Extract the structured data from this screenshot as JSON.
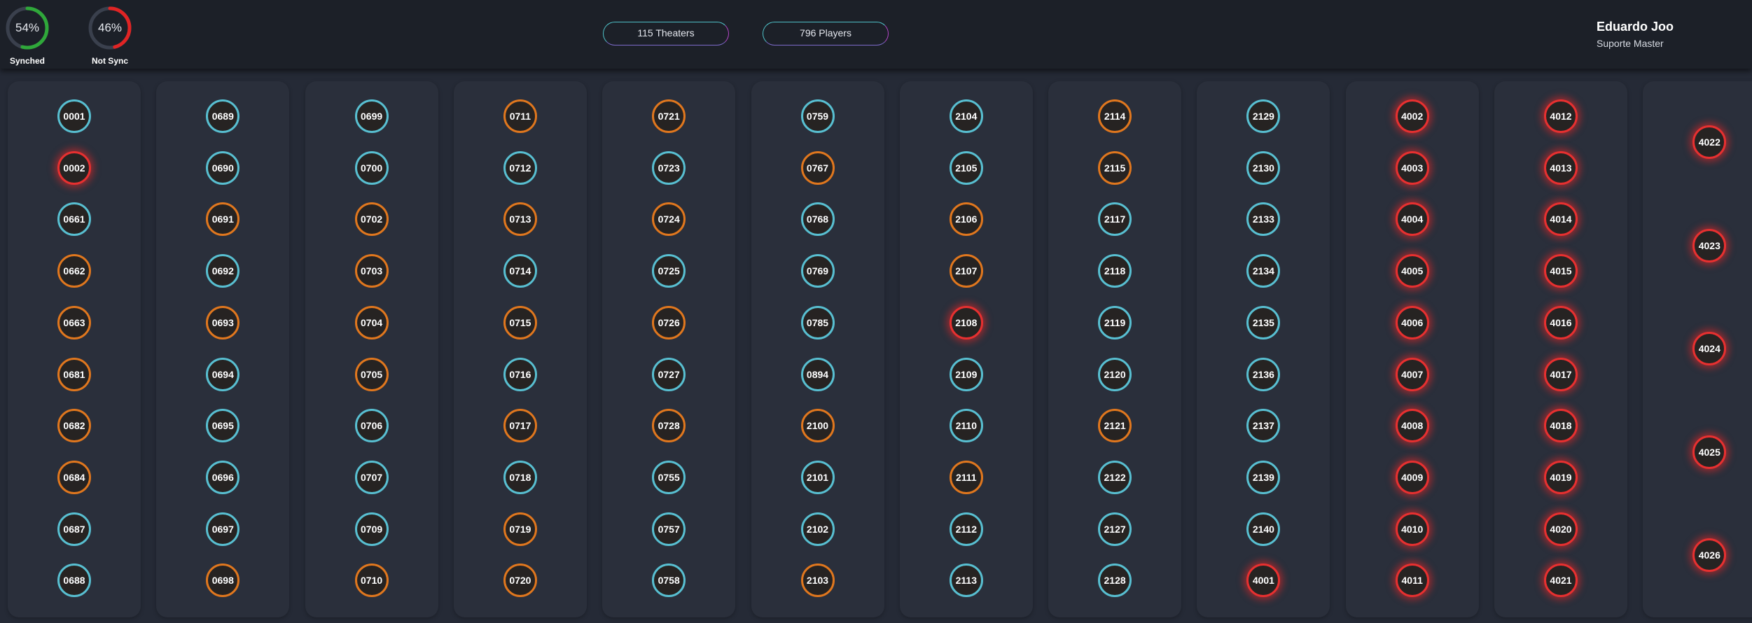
{
  "header": {
    "gauges": [
      {
        "value_text": "54%",
        "label": "Synched",
        "fraction": 0.54,
        "color": "#2fa83a"
      },
      {
        "value_text": "46%",
        "label": "Not Sync",
        "fraction": 0.46,
        "color": "#e02424"
      }
    ],
    "theaters_label": "115 Theaters",
    "players_label": "796 Players",
    "user": {
      "name": "Eduardo Joo",
      "role": "Suporte Master"
    }
  },
  "colors": {
    "ok": "#58bfd1",
    "warn": "#e0771e",
    "err": "#e73030"
  },
  "columns": [
    [
      [
        "0001",
        "ok"
      ],
      [
        "0002",
        "err"
      ],
      [
        "0661",
        "ok"
      ],
      [
        "0662",
        "warn"
      ],
      [
        "0663",
        "warn"
      ],
      [
        "0681",
        "warn"
      ],
      [
        "0682",
        "warn"
      ],
      [
        "0684",
        "warn"
      ],
      [
        "0687",
        "ok"
      ],
      [
        "0688",
        "ok"
      ]
    ],
    [
      [
        "0689",
        "ok"
      ],
      [
        "0690",
        "ok"
      ],
      [
        "0691",
        "warn"
      ],
      [
        "0692",
        "ok"
      ],
      [
        "0693",
        "warn"
      ],
      [
        "0694",
        "ok"
      ],
      [
        "0695",
        "ok"
      ],
      [
        "0696",
        "ok"
      ],
      [
        "0697",
        "ok"
      ],
      [
        "0698",
        "warn"
      ]
    ],
    [
      [
        "0699",
        "ok"
      ],
      [
        "0700",
        "ok"
      ],
      [
        "0702",
        "warn"
      ],
      [
        "0703",
        "warn"
      ],
      [
        "0704",
        "warn"
      ],
      [
        "0705",
        "warn"
      ],
      [
        "0706",
        "ok"
      ],
      [
        "0707",
        "ok"
      ],
      [
        "0709",
        "ok"
      ],
      [
        "0710",
        "warn"
      ]
    ],
    [
      [
        "0711",
        "warn"
      ],
      [
        "0712",
        "ok"
      ],
      [
        "0713",
        "warn"
      ],
      [
        "0714",
        "ok"
      ],
      [
        "0715",
        "warn"
      ],
      [
        "0716",
        "ok"
      ],
      [
        "0717",
        "warn"
      ],
      [
        "0718",
        "ok"
      ],
      [
        "0719",
        "warn"
      ],
      [
        "0720",
        "warn"
      ]
    ],
    [
      [
        "0721",
        "warn"
      ],
      [
        "0723",
        "ok"
      ],
      [
        "0724",
        "warn"
      ],
      [
        "0725",
        "ok"
      ],
      [
        "0726",
        "warn"
      ],
      [
        "0727",
        "ok"
      ],
      [
        "0728",
        "warn"
      ],
      [
        "0755",
        "ok"
      ],
      [
        "0757",
        "ok"
      ],
      [
        "0758",
        "ok"
      ]
    ],
    [
      [
        "0759",
        "ok"
      ],
      [
        "0767",
        "warn"
      ],
      [
        "0768",
        "ok"
      ],
      [
        "0769",
        "ok"
      ],
      [
        "0785",
        "ok"
      ],
      [
        "0894",
        "ok"
      ],
      [
        "2100",
        "warn"
      ],
      [
        "2101",
        "ok"
      ],
      [
        "2102",
        "ok"
      ],
      [
        "2103",
        "warn"
      ]
    ],
    [
      [
        "2104",
        "ok"
      ],
      [
        "2105",
        "ok"
      ],
      [
        "2106",
        "warn"
      ],
      [
        "2107",
        "warn"
      ],
      [
        "2108",
        "err"
      ],
      [
        "2109",
        "ok"
      ],
      [
        "2110",
        "ok"
      ],
      [
        "2111",
        "warn"
      ],
      [
        "2112",
        "ok"
      ],
      [
        "2113",
        "ok"
      ]
    ],
    [
      [
        "2114",
        "warn"
      ],
      [
        "2115",
        "warn"
      ],
      [
        "2117",
        "ok"
      ],
      [
        "2118",
        "ok"
      ],
      [
        "2119",
        "ok"
      ],
      [
        "2120",
        "ok"
      ],
      [
        "2121",
        "warn"
      ],
      [
        "2122",
        "ok"
      ],
      [
        "2127",
        "ok"
      ],
      [
        "2128",
        "ok"
      ]
    ],
    [
      [
        "2129",
        "ok"
      ],
      [
        "2130",
        "ok"
      ],
      [
        "2133",
        "ok"
      ],
      [
        "2134",
        "ok"
      ],
      [
        "2135",
        "ok"
      ],
      [
        "2136",
        "ok"
      ],
      [
        "2137",
        "ok"
      ],
      [
        "2139",
        "ok"
      ],
      [
        "2140",
        "ok"
      ],
      [
        "4001",
        "err"
      ]
    ],
    [
      [
        "4002",
        "err"
      ],
      [
        "4003",
        "err"
      ],
      [
        "4004",
        "err"
      ],
      [
        "4005",
        "err"
      ],
      [
        "4006",
        "err"
      ],
      [
        "4007",
        "err"
      ],
      [
        "4008",
        "err"
      ],
      [
        "4009",
        "err"
      ],
      [
        "4010",
        "err"
      ],
      [
        "4011",
        "err"
      ]
    ],
    [
      [
        "4012",
        "err"
      ],
      [
        "4013",
        "err"
      ],
      [
        "4014",
        "err"
      ],
      [
        "4015",
        "err"
      ],
      [
        "4016",
        "err"
      ],
      [
        "4017",
        "err"
      ],
      [
        "4018",
        "err"
      ],
      [
        "4019",
        "err"
      ],
      [
        "4020",
        "err"
      ],
      [
        "4021",
        "err"
      ]
    ],
    [
      [
        "4022",
        "err"
      ],
      [
        "4023",
        "err"
      ],
      [
        "4024",
        "err"
      ],
      [
        "4025",
        "err"
      ],
      [
        "4026",
        "err"
      ]
    ]
  ]
}
